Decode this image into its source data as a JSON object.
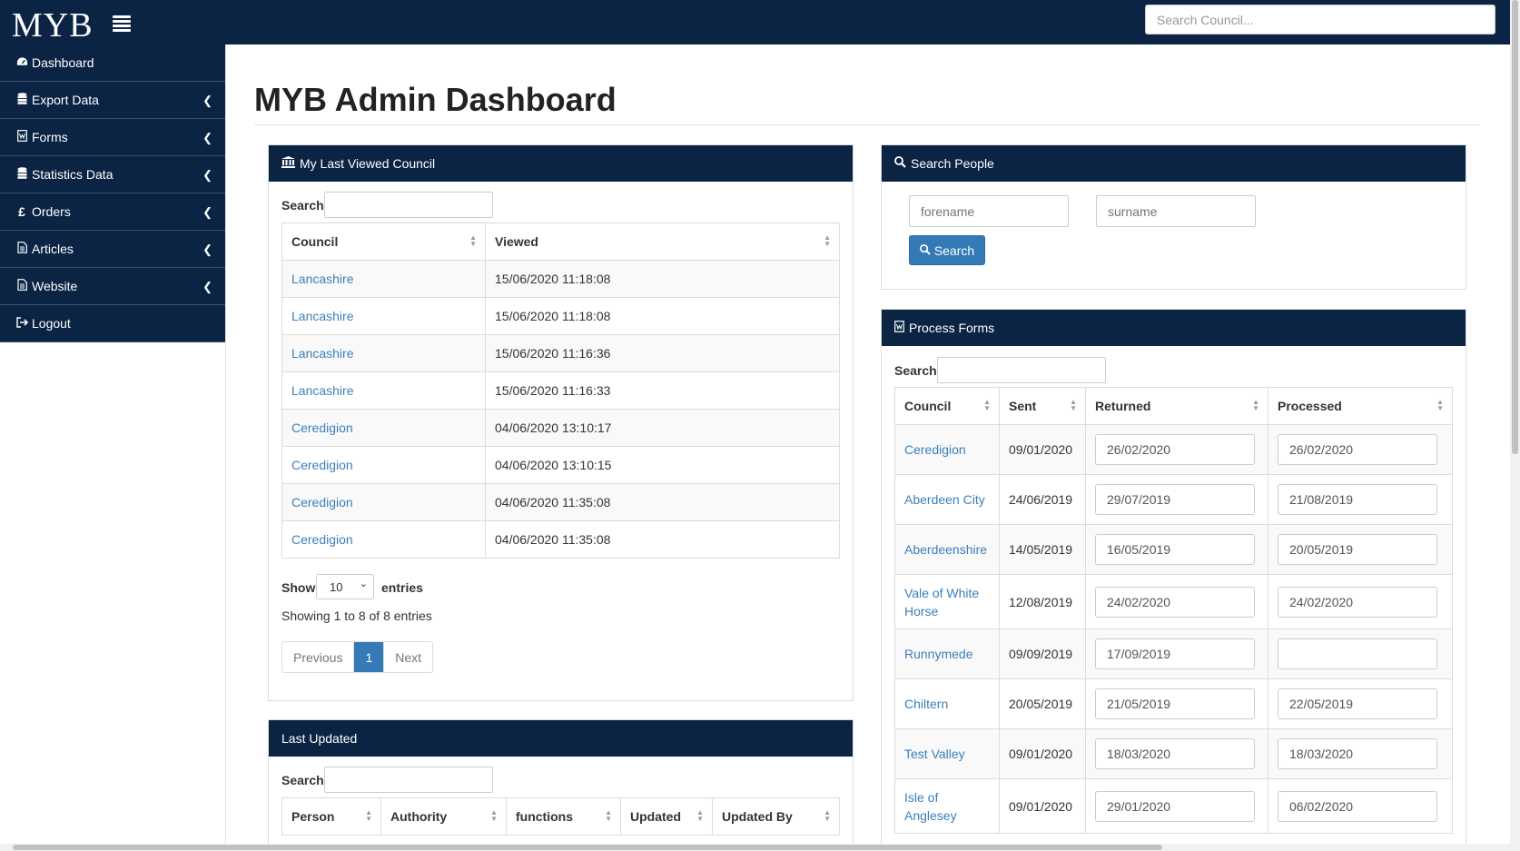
{
  "header": {
    "logo": "MYB",
    "search_placeholder": "Search Council..."
  },
  "sidebar": {
    "items": [
      {
        "label": "Dashboard",
        "icon": "dashboard-icon",
        "has_chevron": false
      },
      {
        "label": "Export Data",
        "icon": "database-icon",
        "has_chevron": true
      },
      {
        "label": "Forms",
        "icon": "form-icon",
        "has_chevron": true
      },
      {
        "label": "Statistics Data",
        "icon": "database-icon",
        "has_chevron": true
      },
      {
        "label": "Orders",
        "icon": "pound-icon",
        "has_chevron": true
      },
      {
        "label": "Articles",
        "icon": "document-icon",
        "has_chevron": true
      },
      {
        "label": "Website",
        "icon": "document-icon",
        "has_chevron": true
      },
      {
        "label": "Logout",
        "icon": "logout-icon",
        "has_chevron": false
      }
    ]
  },
  "page": {
    "title": "MYB Admin Dashboard"
  },
  "last_viewed": {
    "title": "My Last Viewed Council",
    "search_label": "Search:",
    "columns": [
      "Council",
      "Viewed"
    ],
    "rows": [
      {
        "council": "Lancashire",
        "viewed": "15/06/2020 11:18:08"
      },
      {
        "council": "Lancashire",
        "viewed": "15/06/2020 11:18:08"
      },
      {
        "council": "Lancashire",
        "viewed": "15/06/2020 11:16:36"
      },
      {
        "council": "Lancashire",
        "viewed": "15/06/2020 11:16:33"
      },
      {
        "council": "Ceredigion",
        "viewed": "04/06/2020 13:10:17"
      },
      {
        "council": "Ceredigion",
        "viewed": "04/06/2020 13:10:15"
      },
      {
        "council": "Ceredigion",
        "viewed": "04/06/2020 11:35:08"
      },
      {
        "council": "Ceredigion",
        "viewed": "04/06/2020 11:35:08"
      }
    ],
    "show_label": "Show",
    "entries_value": "10",
    "entries_label": "entries",
    "info": "Showing 1 to 8 of 8 entries",
    "pager": {
      "previous": "Previous",
      "current": "1",
      "next": "Next"
    }
  },
  "last_updated": {
    "title": "Last Updated",
    "search_label": "Search:",
    "columns": [
      "Person",
      "Authority",
      "functions",
      "Updated",
      "Updated By"
    ]
  },
  "search_people": {
    "title": "Search People",
    "forename_placeholder": "forename",
    "surname_placeholder": "surname",
    "button_label": "Search"
  },
  "process_forms": {
    "title": "Process Forms",
    "search_label": "Search:",
    "columns": [
      "Council",
      "Sent",
      "Returned",
      "Processed"
    ],
    "rows": [
      {
        "council": "Ceredigion",
        "sent": "09/01/2020",
        "returned": "26/02/2020",
        "processed": "26/02/2020"
      },
      {
        "council": "Aberdeen City",
        "sent": "24/06/2019",
        "returned": "29/07/2019",
        "processed": "21/08/2019"
      },
      {
        "council": "Aberdeenshire",
        "sent": "14/05/2019",
        "returned": "16/05/2019",
        "processed": "20/05/2019"
      },
      {
        "council": "Vale of White Horse",
        "sent": "12/08/2019",
        "returned": "24/02/2020",
        "processed": "24/02/2020"
      },
      {
        "council": "Runnymede",
        "sent": "09/09/2019",
        "returned": "17/09/2019",
        "processed": ""
      },
      {
        "council": "Chiltern",
        "sent": "20/05/2019",
        "returned": "21/05/2019",
        "processed": "22/05/2019"
      },
      {
        "council": "Test Valley",
        "sent": "09/01/2020",
        "returned": "18/03/2020",
        "processed": "18/03/2020"
      },
      {
        "council": "Isle of Anglesey",
        "sent": "09/01/2020",
        "returned": "29/01/2020",
        "processed": "06/02/2020"
      }
    ]
  }
}
